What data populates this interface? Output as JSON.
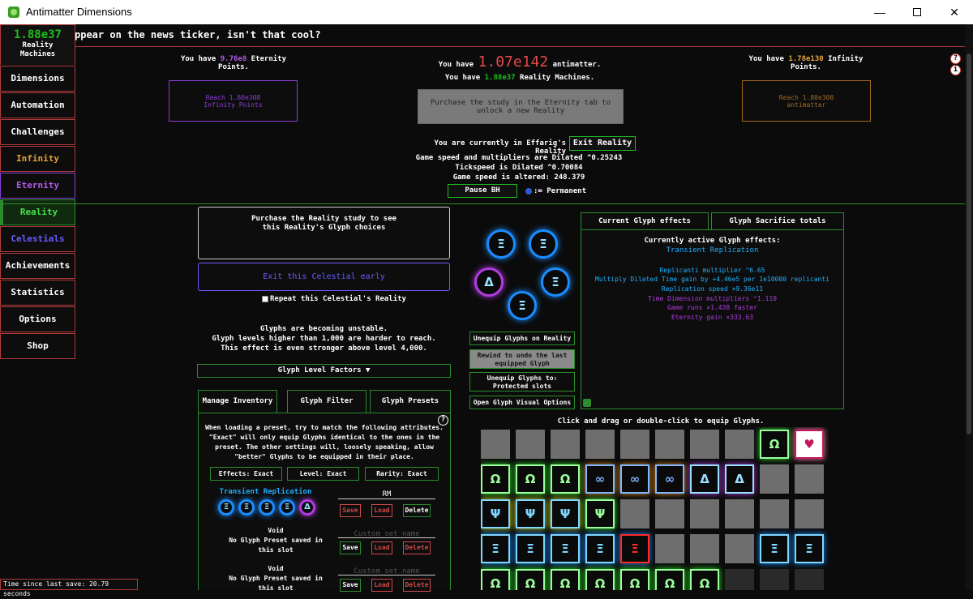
{
  "window": {
    "title": "Antimatter Dimensions",
    "minimize": "—",
    "maximize": "",
    "close": "✕"
  },
  "news": "ppear on the news ticker, isn't that cool?",
  "sidebar": {
    "rm_amount": "1.88e37",
    "rm_label_1": "Reality",
    "rm_label_2": "Machines",
    "items": [
      "Dimensions",
      "Automation",
      "Challenges",
      "Infinity",
      "Eternity",
      "Reality",
      "Celestials",
      "Achievements",
      "Statistics",
      "Options",
      "Shop"
    ]
  },
  "header": {
    "ep_prefix": "You have ",
    "ep_value": "9.76e8",
    "ep_suffix": " Eternity",
    "ep_suffix2": "Points.",
    "am_prefix": "You have ",
    "am_value": "1.07e142",
    "am_suffix": " antimatter.",
    "rm_prefix": "You have ",
    "rm_value": "1.88e37",
    "rm_suffix": " Reality Machines.",
    "ip_prefix": "You have ",
    "ip_value": "1.78e130",
    "ip_suffix": " Infinity",
    "ip_suffix2": "Points.",
    "ep_button_1": "Reach 1.80e308",
    "ep_button_2": "Infinity Points",
    "rm_button_1": "Purchase the study in the Eternity tab to",
    "rm_button_2": "unlock a new Reality",
    "ip_button_1": "Reach 1.80e308",
    "ip_button_2": "antimatter"
  },
  "help": {
    "q": "?",
    "i": "i"
  },
  "reality_status": {
    "current": "You are currently in Effarig's Reality",
    "exit_button": "Exit Reality",
    "dilated": "Game speed and multipliers are Dilated ^0.25243",
    "tickspeed": "Tickspeed is Dilated ^0.70084",
    "altered": "Game speed is altered: 248.379",
    "pause_bh": "Pause BH",
    "bh_status": ":∞ Permanent"
  },
  "left_panel": {
    "choice_1": "Purchase the Reality study to see",
    "choice_2": "this Reality's Glyph choices",
    "exit_celestial": "Exit this Celestial early",
    "repeat": "Repeat this Celestial's Reality",
    "unstable_1": "Glyphs are becoming unstable.",
    "unstable_2": "Glyph levels higher than 1,000 are harder to reach.",
    "unstable_3": "This effect is even stronger above level 4,000.",
    "factors": "Glyph Level Factors ▼",
    "tabs": [
      "Manage Inventory",
      "Glyph Filter",
      "Glyph Presets"
    ],
    "preset_desc_1": "When loading a preset, try to match the following attributes.",
    "preset_desc_2": "\"Exact\" will only equip Glyphs identical to the ones in the",
    "preset_desc_3": "preset. The other settings will, loosely speaking, allow",
    "preset_desc_4": "\"better\" Glyphs to be equipped in their place.",
    "effects_exact": "Effects: Exact",
    "level_exact": "Level: Exact",
    "rarity_exact": "Rarity: Exact",
    "preset_name": "Transient Replication",
    "rm_label": "RM",
    "save": "Save",
    "load": "Load",
    "delete": "Delete",
    "custom_name": "Custom set name",
    "void": "Void",
    "no_preset_1": "No Glyph Preset saved in",
    "no_preset_2": "this slot"
  },
  "glyph_controls": {
    "unequip_reality": "Unequip Glyphs on Reality",
    "rewind_1": "Rewind to undo the last",
    "rewind_2": "equipped Glyph",
    "unequip_to_1": "Unequip Glyphs to:",
    "unequip_to_2": "Protected slots",
    "visual": "Open Glyph Visual Options"
  },
  "effects": {
    "tab_current": "Current Glyph effects",
    "tab_sacrifice": "Glyph Sacrifice totals",
    "heading": "Currently active Glyph effects:",
    "set_name": "Transient Replication",
    "lines": [
      "Replicanti multiplier ^6.65",
      "Multiply Dilated Time gain by +4.46e5 per 1e10000 replicanti",
      "Replication speed ×9.36e11",
      "Time Dimension multipliers ^1.110",
      "Game runs ×1.438 faster",
      "Eternity gain ×333.63"
    ],
    "line_colors": [
      "#1fb0ff",
      "#1fb0ff",
      "#1fb0ff",
      "#b03ce0",
      "#b03ce0",
      "#b03ce0"
    ]
  },
  "inventory": {
    "hint": "Click and drag or double-click to equip Glyphs.",
    "symbols": {
      "time": "Ω",
      "replication": "Ξ",
      "infinity": "∞",
      "dilation": "Δ",
      "power": "Ψ",
      "companion": "♥"
    }
  },
  "status": {
    "save_time": "Time since last save: 20.79 seconds"
  }
}
